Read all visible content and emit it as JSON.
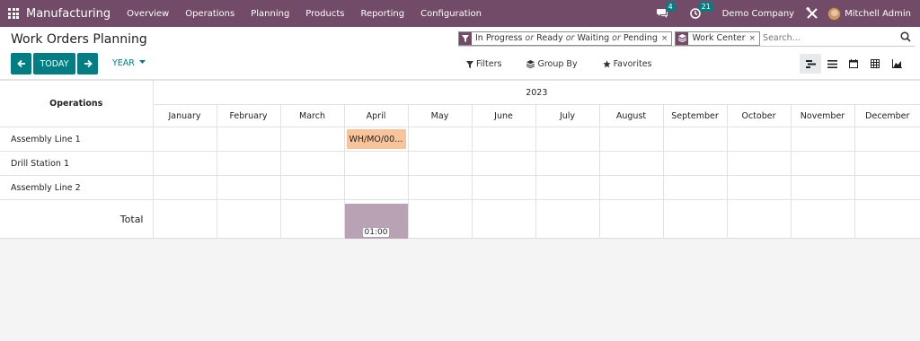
{
  "navbar": {
    "app_name": "Manufacturing",
    "menu": [
      "Overview",
      "Operations",
      "Planning",
      "Products",
      "Reporting",
      "Configuration"
    ],
    "messages_count": "4",
    "activities_count": "21",
    "company": "Demo Company",
    "user": "Mitchell Admin"
  },
  "control_panel": {
    "title": "Work Orders Planning",
    "facet_status": {
      "values": [
        "In Progress",
        "Ready",
        "Waiting",
        "Pending"
      ],
      "separator": "or"
    },
    "facet_groupby": "Work Center",
    "search_placeholder": "Search...",
    "today_label": "TODAY",
    "scale_label": "YEAR",
    "filters_label": "Filters",
    "groupby_label": "Group By",
    "favorites_label": "Favorites"
  },
  "gantt": {
    "year": "2023",
    "rows_header": "Operations",
    "months": [
      "January",
      "February",
      "March",
      "April",
      "May",
      "June",
      "July",
      "August",
      "September",
      "October",
      "November",
      "December"
    ],
    "rows": [
      {
        "label": "Assembly Line 1",
        "pill": {
          "month_index": 3,
          "text": "WH/MO/00..."
        }
      },
      {
        "label": "Drill Station 1",
        "pill": null
      },
      {
        "label": "Assembly Line 2",
        "pill": null
      }
    ],
    "total_label": "Total",
    "total": {
      "month_index": 3,
      "value": "01:00"
    }
  },
  "colors": {
    "navbar": "#714b67",
    "primary": "#017e84",
    "pill": "#f7c49c",
    "total_bar": "#b9a2b3"
  }
}
